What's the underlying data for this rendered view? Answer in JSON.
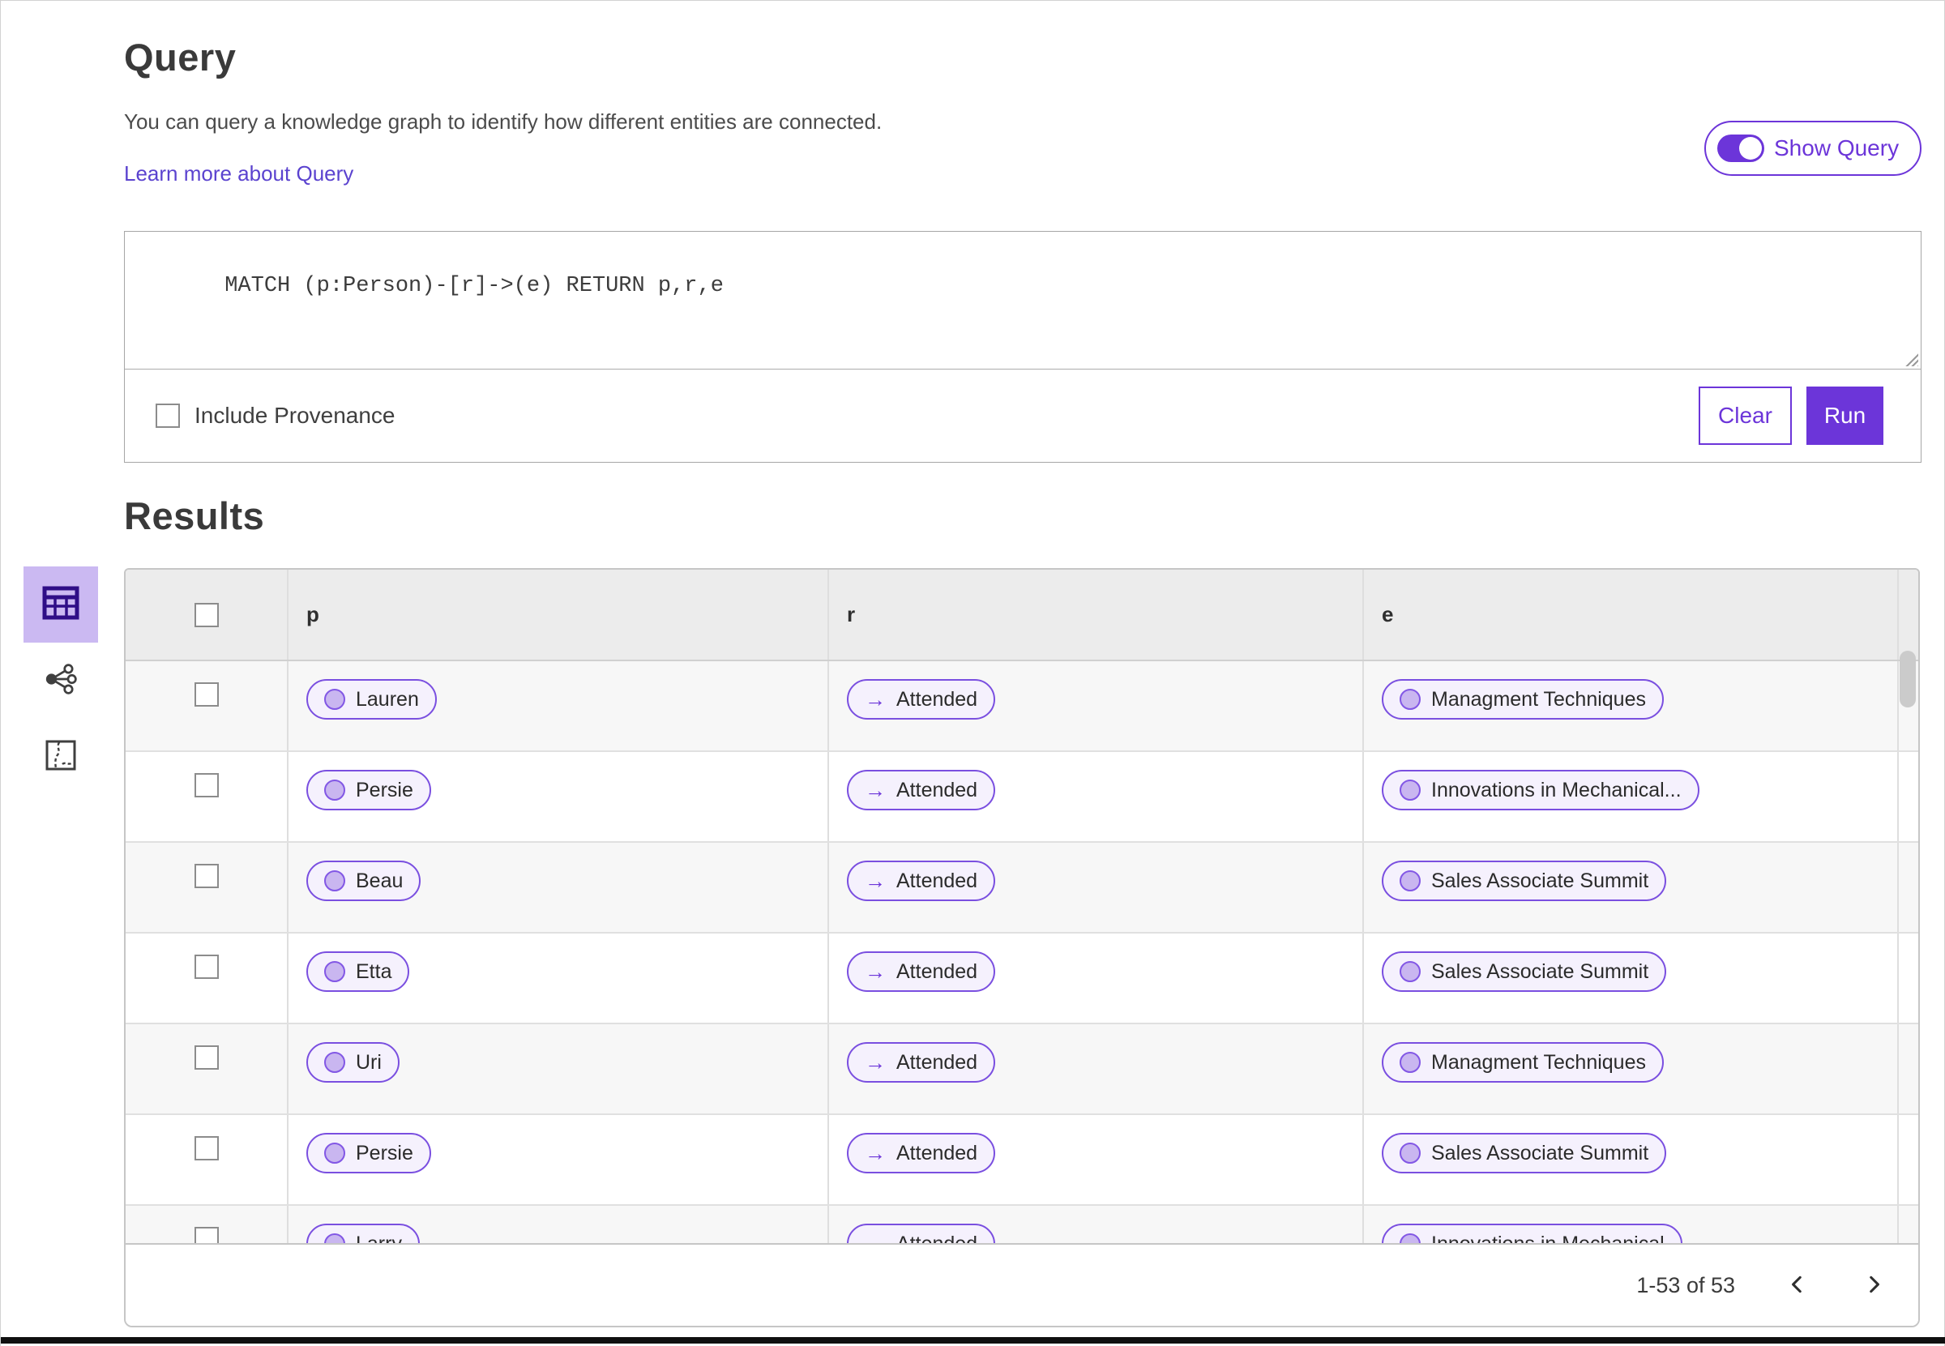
{
  "query": {
    "title": "Query",
    "description": "You can query a knowledge graph to identify how different entities are connected.",
    "learn_more_label": "Learn more about Query",
    "show_query_label": "Show Query",
    "query_text": "MATCH (p:Person)-[r]->(e) RETURN p,r,e",
    "include_provenance_label": "Include Provenance",
    "clear_label": "Clear",
    "run_label": "Run"
  },
  "results": {
    "title": "Results",
    "views": [
      {
        "name": "table-view",
        "selected": true
      },
      {
        "name": "graph-view",
        "selected": false
      },
      {
        "name": "map-view",
        "selected": false
      }
    ],
    "table": {
      "columns": [
        "p",
        "r",
        "e"
      ],
      "arrow_glyph": "→",
      "rows": [
        {
          "p": "Lauren",
          "r": "Attended",
          "e": "Managment Techniques"
        },
        {
          "p": "Persie",
          "r": "Attended",
          "e": "Innovations in Mechanical..."
        },
        {
          "p": "Beau",
          "r": "Attended",
          "e": "Sales Associate Summit"
        },
        {
          "p": "Etta",
          "r": "Attended",
          "e": "Sales Associate Summit"
        },
        {
          "p": "Uri",
          "r": "Attended",
          "e": "Managment Techniques"
        },
        {
          "p": "Persie",
          "r": "Attended",
          "e": "Sales Associate Summit"
        },
        {
          "p": "Larry",
          "r": "Attended",
          "e": "Innovations in Mechanical"
        }
      ]
    },
    "pagination": {
      "range_label": "1-53 of 53"
    }
  },
  "colors": {
    "accent_purple": "#6c35d9",
    "link_purple": "#5b43cf",
    "pill_border": "#7a4fe0",
    "pill_background": "#f5f1fd",
    "node_fill": "#c9b6f0",
    "selected_tile_background": "#cbb9f2",
    "table_icon_purple": "#2f0e87",
    "header_background": "#ececec",
    "alt_row_background": "#f7f7f7"
  }
}
